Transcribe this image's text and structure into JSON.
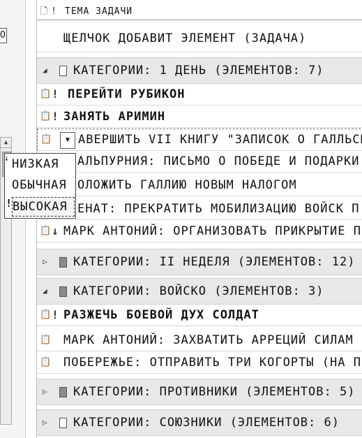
{
  "left_pane": {
    "input_value": "O"
  },
  "header": {
    "icon_col": "🗋",
    "prio_col": "!",
    "subject_col": "ТЕМА ЗАДАЧИ"
  },
  "new_item_prompt": "ЩЕЛЧОК ДОБАВИТ ЭЛЕМЕНТ (ЗАДАЧА)",
  "groups": [
    {
      "label": "КАТЕГОРИИ: 1 ДЕНЬ (ЭЛЕМЕНТОВ: 7)",
      "expanded": true,
      "tasks": [
        {
          "prio": "!",
          "subject": "ПЕРЕЙТИ РУБИКОН",
          "bold": true
        },
        {
          "prio": "!",
          "subject": "ЗАНЯТЬ АРИМИН",
          "bold": true
        },
        {
          "prio": "▾",
          "subject": "АВЕРШИТЬ VII КНИГУ \"ЗАПИСОК О ГАЛЛЬСКОЙ",
          "bold": false
        },
        {
          "prio": "",
          "subject": "АЛЬПУРНИЯ: ПИСЬМО О ПОБЕДЕ И ПОДАРКИ",
          "bold": false
        },
        {
          "prio": "",
          "subject": "ОЛОЖИТЬ ГАЛЛИЮ НОВЫМ НАЛОГОМ",
          "bold": false
        },
        {
          "prio": "",
          "subject": "ЕНАТ: ПРЕКРАТИТЬ МОБИЛИЗАЦИЮ ВОЙСК П",
          "bold": false
        },
        {
          "prio": "↓",
          "subject": "МАРК АНТОНИЙ: ОРГАНИЗОВАТЬ ПРИКРЫТИЕ П",
          "bold": false
        }
      ]
    },
    {
      "label": "КАТЕГОРИИ: II НЕДЕЛЯ (ЭЛЕМЕНТОВ: 12)",
      "expanded": false
    },
    {
      "label": "КАТЕГОРИИ: ВОЙСКО (ЭЛЕМЕНТОВ: 3)",
      "expanded": true,
      "tasks": [
        {
          "prio": "!",
          "subject": "РАЗЖЕЧЬ БОЕВОЙ ДУХ СОЛДАТ",
          "bold": true
        },
        {
          "prio": "",
          "subject": "МАРК АНТОНИЙ: ЗАХВАТИТЬ АРРЕЦИЙ СИЛАМ",
          "bold": false
        },
        {
          "prio": "",
          "subject": "ПОБЕРЕЖЬЕ: ОТПРАВИТЬ ТРИ КОГОРТЫ (НА ПИ",
          "bold": false
        }
      ]
    },
    {
      "label": "КАТЕГОРИИ: ПРОТИВНИКИ (ЭЛЕМЕНТОВ: 5)",
      "expanded": false
    },
    {
      "label": "КАТЕГОРИИ: СОЮЗНИКИ (ЭЛЕМЕНТОВ: 6)",
      "expanded": false
    }
  ],
  "priority_dropdown": {
    "options": [
      "НИЗКАЯ",
      "ОБЫЧНАЯ",
      "ВЫСОКАЯ"
    ],
    "selected": "ВЫСОКАЯ"
  },
  "icons": {
    "task": "task-clipboard-icon",
    "expand": "triangle-right-icon",
    "collapse": "triangle-down-icon"
  }
}
